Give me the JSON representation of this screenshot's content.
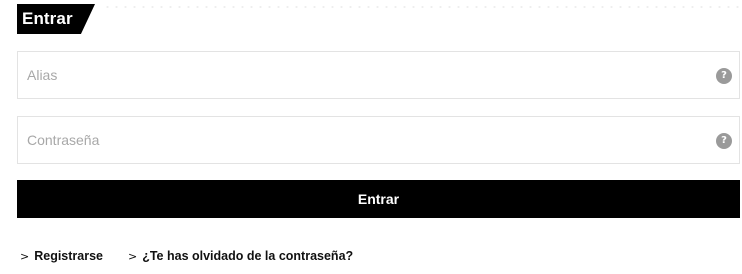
{
  "header": {
    "title": "Entrar"
  },
  "form": {
    "alias_placeholder": "Alias",
    "password_placeholder": "Contraseña",
    "help_glyph": "?",
    "submit_label": "Entrar"
  },
  "links": {
    "chevron": ">",
    "register_label": "Registrarse",
    "forgot_label": "¿Te has olvidado de la contraseña?"
  },
  "colors": {
    "primary": "#000000",
    "background": "#ffffff",
    "help_icon": "#9a9a9a"
  },
  "icons": {
    "help": "help-circle-icon",
    "chevron": "chevron-right-icon"
  }
}
